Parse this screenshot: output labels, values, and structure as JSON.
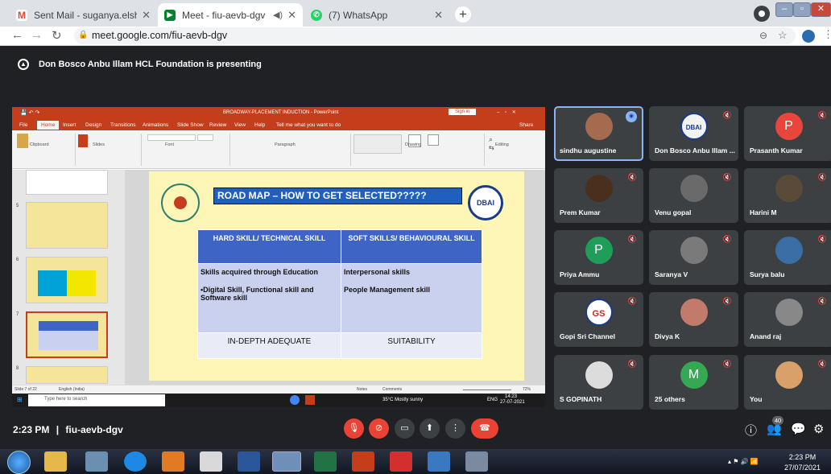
{
  "browser": {
    "tabs": [
      {
        "label": "Sent Mail - suganya.elshadai@gm",
        "icon": "gmail-icon"
      },
      {
        "label": "Meet - fiu-aevb-dgv",
        "icon": "meet-icon"
      },
      {
        "label": "(7) WhatsApp",
        "icon": "whatsapp-icon"
      }
    ],
    "url": "meet.google.com/fiu-aevb-dgv"
  },
  "meet": {
    "presenting_text": "Don Bosco Anbu Illam HCL Foundation is presenting",
    "time": "2:23 PM",
    "separator": "|",
    "meeting_code": "fiu-aevb-dgv",
    "people_count": "40",
    "participants": [
      {
        "name": "sindhu augustine",
        "avatar": "photo",
        "color": "#a56b4f"
      },
      {
        "name": "Don Bosco Anbu Illam ...",
        "avatar": "DBAI",
        "color": "#f2f2f2"
      },
      {
        "name": "Prasanth Kumar",
        "avatar": "P",
        "color": "#e8453c"
      },
      {
        "name": "Prem Kumar",
        "avatar": "photo",
        "color": "#4a2f1e"
      },
      {
        "name": "Venu gopal",
        "avatar": "photo",
        "color": "#6a6a6a"
      },
      {
        "name": "Harini M",
        "avatar": "photo",
        "color": "#5a4a3a"
      },
      {
        "name": "Priya Ammu",
        "avatar": "P",
        "color": "#1e9e58"
      },
      {
        "name": "Saranya V",
        "avatar": "photo",
        "color": "#7a7a7a"
      },
      {
        "name": "Surya balu",
        "avatar": "photo",
        "color": "#3a6ea5"
      },
      {
        "name": "Gopi Sri Channel",
        "avatar": "GS",
        "color": "#ffffff"
      },
      {
        "name": "Divya K",
        "avatar": "photo",
        "color": "#c27a6a"
      },
      {
        "name": "Anand raj",
        "avatar": "photo",
        "color": "#888888"
      },
      {
        "name": "S GOPINATH",
        "avatar": "photo",
        "color": "#dcdcdc"
      },
      {
        "name": "25 others",
        "avatar": "M",
        "color": "#34a853"
      },
      {
        "name": "You",
        "avatar": "photo",
        "color": "#d9a06a"
      }
    ]
  },
  "ppt": {
    "title": "BROADWAY-PLACEMENT INDUCTION  -  PowerPoint",
    "signin": "Sign in",
    "share": "Share",
    "tell_me": "Tell me what you want to do",
    "ribbon_tabs": [
      "File",
      "Home",
      "Insert",
      "Design",
      "Transitions",
      "Animations",
      "Slide Show",
      "Review",
      "View",
      "Help"
    ],
    "groups": [
      "Clipboard",
      "Slides",
      "Font",
      "Paragraph",
      "Drawing",
      "Editing"
    ],
    "slide_numbers": [
      "5",
      "6",
      "7",
      "8"
    ],
    "status_left": "Slide 7 of 22",
    "status_lang": "English (India)",
    "status_notes": "Notes",
    "status_comments": "Comments",
    "status_zoom": "72%",
    "slide": {
      "title": "ROAD MAP – HOW TO GET SELECTED?????",
      "logo": "DBAI",
      "col1_header": "HARD SKILL/ TECHNICAL SKILL",
      "col2_header": "SOFT SKILLS/ BEHAVIOURAL SKILL",
      "col1_line1": "Skills acquired through Education",
      "col1_line2": "•Digital Skill, Functional skill and Software skill",
      "col2_line1": "Interpersonal skills",
      "col2_line2": "People Management skill",
      "col1_footer": "IN-DEPTH ADEQUATE",
      "col2_footer": "SUITABILITY"
    },
    "taskbar": {
      "search": "Type here to search",
      "weather": "35°C  Mostly sunny",
      "lang": "ENG",
      "time": "14:23",
      "date": "27-07-2021"
    }
  },
  "windows_taskbar": {
    "time": "2:23 PM",
    "date": "27/07/2021"
  }
}
